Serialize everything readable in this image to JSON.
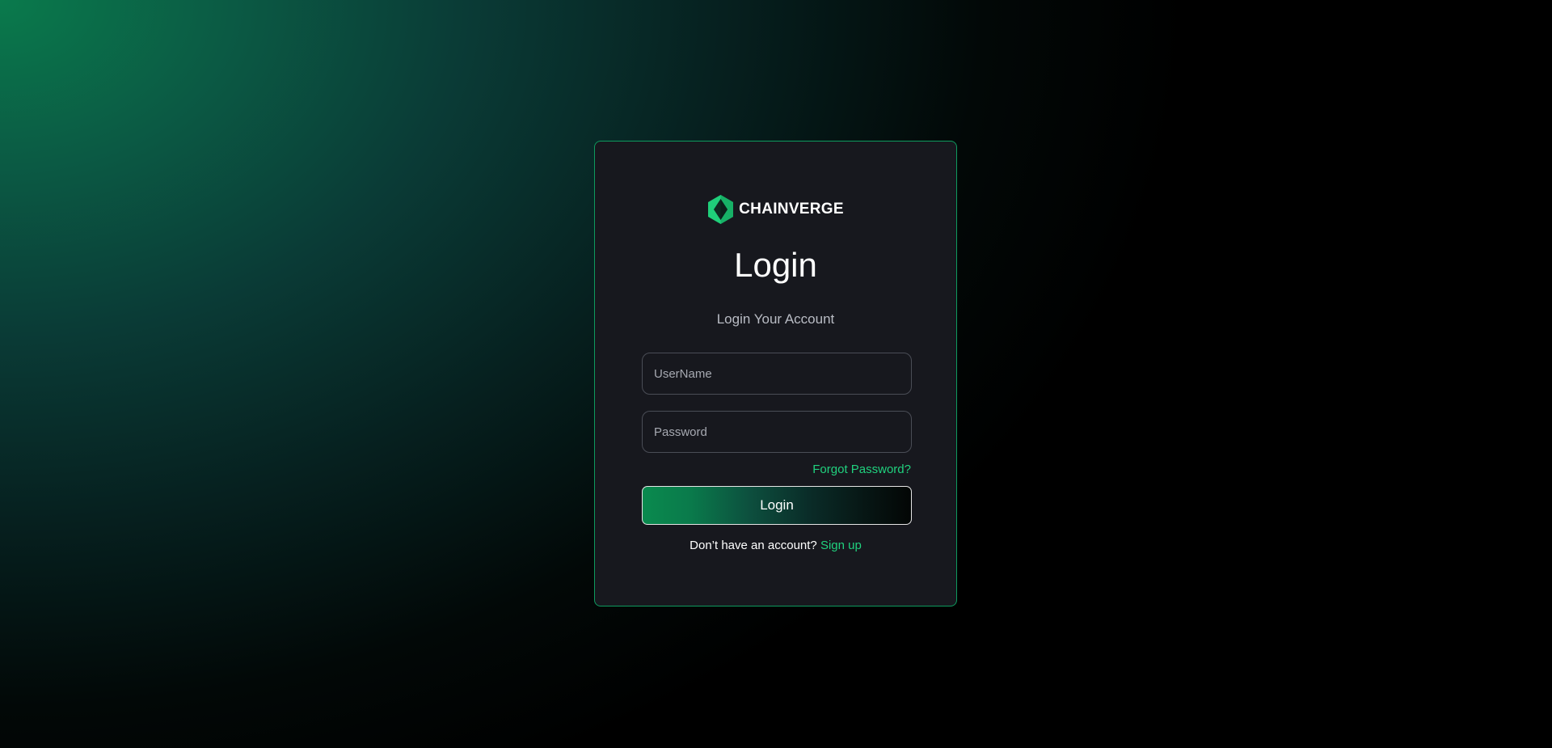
{
  "brand": {
    "name": "CHAINVERGE",
    "icon": "hexagon-diamond-logo-icon",
    "accent_color": "#20d17e"
  },
  "login_form": {
    "title": "Login",
    "subtitle": "Login Your Account",
    "username": {
      "value": "",
      "placeholder": "UserName"
    },
    "password": {
      "value": "",
      "placeholder": "Password"
    },
    "forgot_password_label": "Forgot Password?",
    "submit_label": "Login",
    "signup_prompt": "Don’t have an account?",
    "signup_label": "Sign up"
  }
}
